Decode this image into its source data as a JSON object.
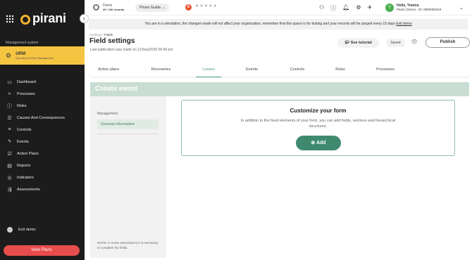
{
  "brand": {
    "name": "pirani"
  },
  "sidebar": {
    "section_label": "Management system",
    "orm": {
      "title": "ORM",
      "subtitle": "Operational Risk Management"
    },
    "items": [
      {
        "label": "Dashboard",
        "icon": "monitor-icon"
      },
      {
        "label": "Processes",
        "icon": "chevrons-icon"
      },
      {
        "label": "Risks",
        "icon": "alert-icon"
      },
      {
        "label": "Causes And Consequences",
        "icon": "list-icon"
      },
      {
        "label": "Controls",
        "icon": "sliders-icon"
      },
      {
        "label": "Events",
        "icon": "lightning-icon"
      },
      {
        "label": "Action Plans",
        "icon": "checkbox-icon"
      },
      {
        "label": "Reports",
        "icon": "document-icon"
      },
      {
        "label": "Indicators",
        "icon": "target-icon"
      },
      {
        "label": "Assessments",
        "icon": "assessment-icon"
      }
    ],
    "exit_label": "Exit demo",
    "view_plans_label": "View Plans",
    "view_plans_color": "#e84d4d",
    "accent_color": "#f5c542"
  },
  "topbar": {
    "demo_label": "Demo",
    "demo_records": "29 / 100 records",
    "guide_label": "Pirani Guide",
    "user_greeting": "Hello, Yomira",
    "user_info": "Pirani | Demo - ID: 0000000419",
    "avatar_letter": "Y"
  },
  "banner": {
    "text": "You are in a simulation, the changes made will not affect your organization, remember that this space is for testing and your records will be purged every 15 days",
    "link": "Exit demo"
  },
  "page": {
    "crumb_parent": "Settings",
    "crumb_current": "Fields",
    "title": "Field settings",
    "last_publication": "Last publication was made on 11/Sep/2025 06:40 pm",
    "tutorial_label": "See tutorial",
    "saved_label": "Saved",
    "publish_label": "Publish"
  },
  "tabs": [
    {
      "label": "Action plans"
    },
    {
      "label": "Recoveries"
    },
    {
      "label": "Losses",
      "active": true
    },
    {
      "label": "Events"
    },
    {
      "label": "Controls"
    },
    {
      "label": "Risks"
    },
    {
      "label": "Processes"
    }
  ],
  "form": {
    "header": "Create event",
    "left_label": "Management",
    "left_item": "General information",
    "note": "NOTE: In some associations it is necessary to complete the fields.",
    "customize_title": "Customize your form",
    "customize_desc": "In addition to the fixed elements of your form, you can add fields, sections and hierarchical structures.",
    "add_label": "Add",
    "primary_color": "#3f8a6f"
  }
}
